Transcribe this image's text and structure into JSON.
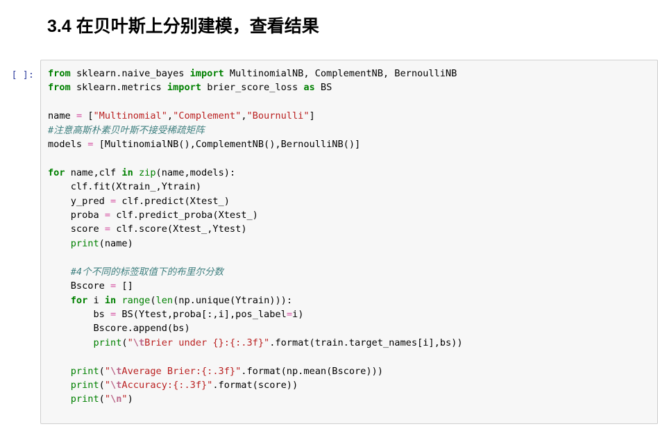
{
  "notebook": {
    "heading_cell": {
      "text": "3.4 在贝叶斯上分别建模，查看结果"
    },
    "code_cell": {
      "prompt": "[ ]:",
      "language": "python",
      "lines": [
        "from sklearn.naive_bayes import MultinomialNB, ComplementNB, BernoulliNB",
        "from sklearn.metrics import brier_score_loss as BS",
        "",
        "name = [\"Multinomial\",\"Complement\",\"Bournulli\"]",
        "#注意高斯朴素贝叶斯不接受稀疏矩阵",
        "models = [MultinomialNB(),ComplementNB(),BernoulliNB()]",
        "",
        "for name,clf in zip(name,models):",
        "    clf.fit(Xtrain_,Ytrain)",
        "    y_pred = clf.predict(Xtest_)",
        "    proba = clf.predict_proba(Xtest_)",
        "    score = clf.score(Xtest_,Ytest)",
        "    print(name)",
        "",
        "    #4个不同的标签取值下的布里尔分数",
        "    Bscore = []",
        "    for i in range(len(np.unique(Ytrain))):",
        "        bs = BS(Ytest,proba[:,i],pos_label=i)",
        "        Bscore.append(bs)",
        "        print(\"\\tBrier under {}:{:.3f}\".format(train.target_names[i],bs))",
        "",
        "    print(\"\\tAverage Brier:{:.3f}\".format(np.mean(Bscore)))",
        "    print(\"\\tAccuracy:{:.3f}\".format(score))",
        "    print(\"\\n\")"
      ]
    }
  },
  "colors": {
    "cell_background": "#f7f7f7",
    "cell_border": "#cfcfcf",
    "prompt_text": "#303F9F",
    "keyword": "#008000",
    "builtin": "#008000",
    "string": "#BA2121",
    "string_escape": "#BB6688",
    "comment": "#408080",
    "operator": "#AA22FF",
    "page_background": "#ffffff",
    "heading_text": "#000000"
  }
}
